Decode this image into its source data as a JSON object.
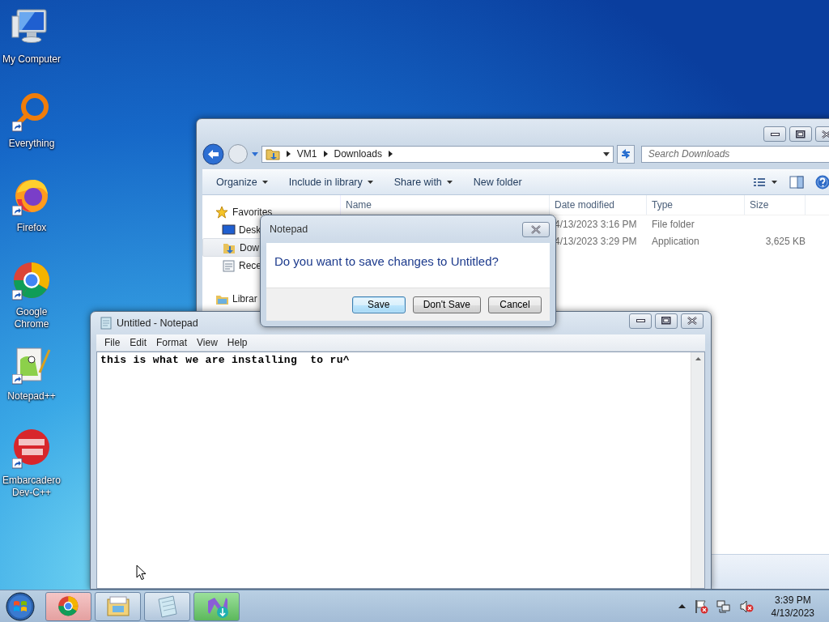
{
  "desktop_icons": [
    {
      "label": "My Computer",
      "kind": "computer",
      "shortcut": false
    },
    {
      "label": "Everything",
      "kind": "everything",
      "shortcut": true
    },
    {
      "label": "Firefox",
      "kind": "firefox",
      "shortcut": true
    },
    {
      "label": "Google Chrome",
      "kind": "chrome",
      "shortcut": true
    },
    {
      "label": "Notepad++",
      "kind": "notepadpp",
      "shortcut": true
    },
    {
      "label": "Embarcadero Dev-C++",
      "kind": "devcpp",
      "shortcut": true
    }
  ],
  "explorer": {
    "path": [
      "VM1",
      "Downloads"
    ],
    "search": {
      "placeholder": "Search Downloads"
    },
    "toolbar": [
      {
        "label": "Organize",
        "dropdown": true
      },
      {
        "label": "Include in library",
        "dropdown": true
      },
      {
        "label": "Share with",
        "dropdown": true
      },
      {
        "label": "New folder",
        "dropdown": false
      }
    ],
    "nav": [
      {
        "label": "Favorites",
        "kind": "favorites",
        "selected": false
      },
      {
        "label": "Desk",
        "kind": "desktop",
        "selected": false
      },
      {
        "label": "Dow",
        "kind": "downloads",
        "selected": true
      },
      {
        "label": "Rece",
        "kind": "recent",
        "selected": false
      },
      {
        "label": "Librar",
        "kind": "libraries",
        "selected": false
      }
    ],
    "columns": [
      "Name",
      "Date modified",
      "Type",
      "Size"
    ],
    "rows": [
      {
        "date": "4/13/2023 3:16 PM",
        "type": "File folder"
      },
      {
        "date": "4/13/2023 3:29 PM",
        "type": "Application",
        "size": "3,625 KB"
      }
    ]
  },
  "notepad": {
    "title": "Untitled - Notepad",
    "menu": [
      "File",
      "Edit",
      "Format",
      "View",
      "Help"
    ],
    "text": "this is what we are installing  to ru^"
  },
  "dialog": {
    "title": "Notepad",
    "message": "Do you want to save changes to Untitled?",
    "buttons": [
      {
        "label": "Save",
        "selected": true
      },
      {
        "label": "Don't Save",
        "selected": false
      },
      {
        "label": "Cancel",
        "selected": false
      }
    ]
  },
  "taskbar": {
    "buttons": [
      {
        "kind": "chrome"
      },
      {
        "kind": "explorer"
      },
      {
        "kind": "notepad"
      },
      {
        "kind": "installer"
      }
    ],
    "clock": {
      "time": "3:39 PM",
      "date": "4/13/2023"
    }
  }
}
